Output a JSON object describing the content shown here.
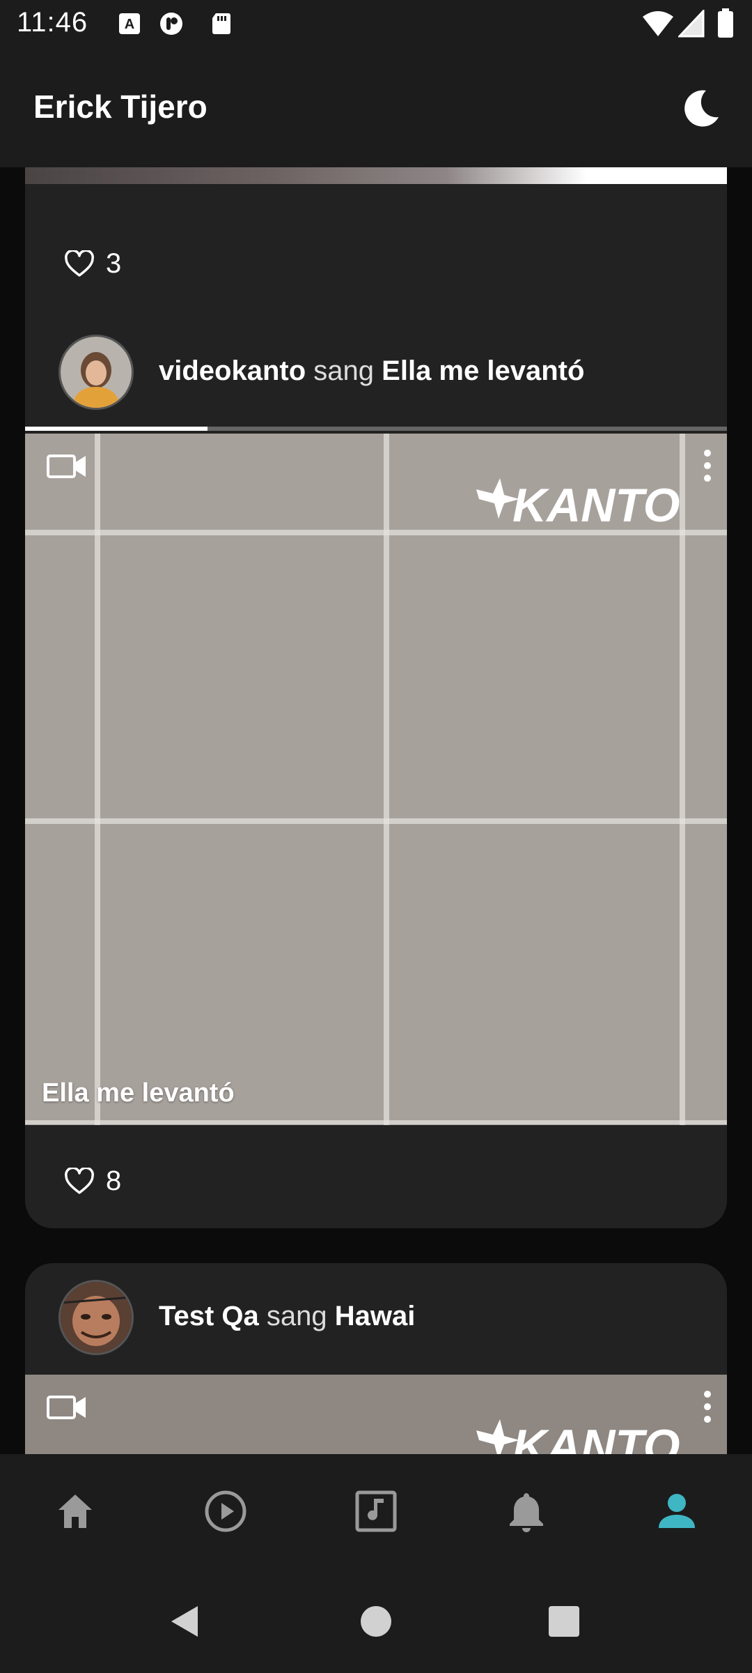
{
  "status_bar": {
    "time": "11:46",
    "icons": [
      "a-notification-icon",
      "podcast-icon",
      "sd-card-icon",
      "wifi-icon",
      "cellular-icon",
      "battery-icon"
    ]
  },
  "app_bar": {
    "title": "Erick Tijero",
    "theme_icon": "moon-icon"
  },
  "feed": {
    "cards": [
      {
        "likes": "3"
      },
      {
        "user": "videokanto",
        "verb": "sang",
        "song": "Ella me levantó",
        "progress": 0.26,
        "overlay_title": "Ella me levantó",
        "brand": "KANTO",
        "likes": "8"
      },
      {
        "user": "Test Qa",
        "verb": "sang",
        "song": "Hawai",
        "brand": "KANTO"
      }
    ]
  },
  "bottom_nav": {
    "items": [
      {
        "icon": "home-icon",
        "active": false
      },
      {
        "icon": "play-circle-icon",
        "active": false
      },
      {
        "icon": "music-note-icon",
        "active": false
      },
      {
        "icon": "bell-icon",
        "active": false
      },
      {
        "icon": "profile-icon",
        "active": true
      }
    ],
    "active_color": "#3fb6c4",
    "inactive_color": "#9a9a9a"
  },
  "system_nav": {
    "buttons": [
      "back-icon",
      "home-circle-icon",
      "recents-icon"
    ]
  }
}
